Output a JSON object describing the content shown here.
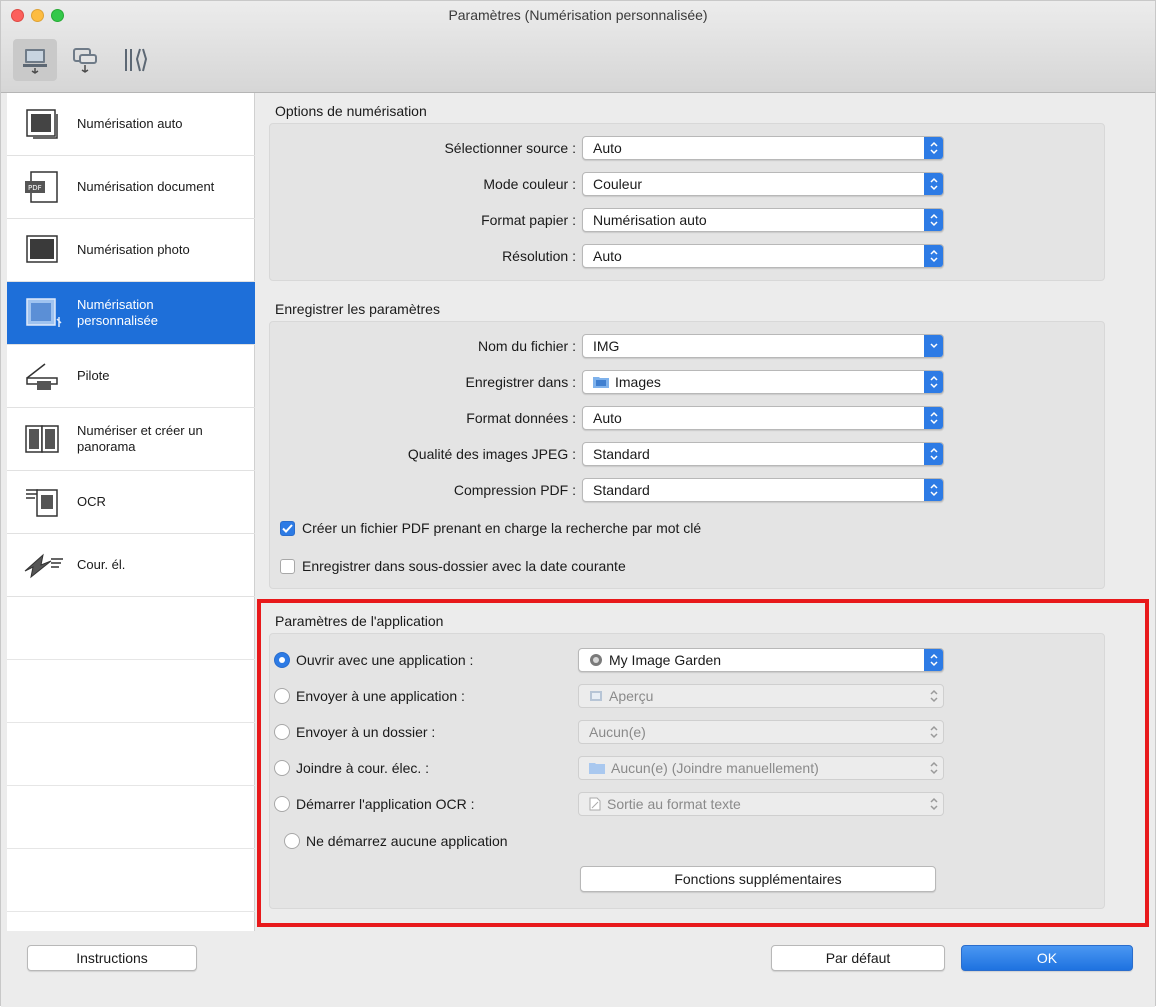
{
  "window": {
    "title": "Paramètres (Numérisation personnalisée)"
  },
  "toolbar": {
    "items": [
      {
        "icon": "computer-scan-icon",
        "active": true
      },
      {
        "icon": "network-scan-icon",
        "active": false
      },
      {
        "icon": "general-settings-icon",
        "active": false
      }
    ]
  },
  "sidebar": {
    "items": [
      {
        "label": "Numérisation auto",
        "icon": "auto-scan-icon"
      },
      {
        "label": "Numérisation document",
        "icon": "document-scan-icon"
      },
      {
        "label": "Numérisation photo",
        "icon": "photo-scan-icon"
      },
      {
        "label": "Numérisation personnalisée",
        "icon": "custom-scan-icon",
        "selected": true
      },
      {
        "label": "Pilote",
        "icon": "driver-icon"
      },
      {
        "label": "Numériser et créer un panorama",
        "icon": "panorama-icon"
      },
      {
        "label": "OCR",
        "icon": "ocr-icon"
      },
      {
        "label": "Cour. él.",
        "icon": "email-icon"
      }
    ]
  },
  "scan_options": {
    "title": "Options de numérisation",
    "rows": [
      {
        "label": "Sélectionner source :",
        "value": "Auto"
      },
      {
        "label": "Mode couleur :",
        "value": "Couleur"
      },
      {
        "label": "Format papier :",
        "value": "Numérisation auto"
      },
      {
        "label": "Résolution :",
        "value": "Auto"
      }
    ]
  },
  "save_settings": {
    "title": "Enregistrer les paramètres",
    "rows": [
      {
        "label": "Nom du fichier :",
        "value": "IMG"
      },
      {
        "label": "Enregistrer dans :",
        "value": "Images"
      },
      {
        "label": "Format données :",
        "value": "Auto"
      },
      {
        "label": "Qualité des images JPEG :",
        "value": "Standard"
      },
      {
        "label": "Compression PDF :",
        "value": "Standard"
      }
    ],
    "checkboxes": [
      {
        "label": "Créer un fichier PDF prenant en charge la recherche par mot clé",
        "checked": true
      },
      {
        "label": "Enregistrer dans sous-dossier avec la date courante",
        "checked": false
      }
    ]
  },
  "app_settings": {
    "title": "Paramètres de l'application",
    "options": [
      {
        "label": "Ouvrir avec une application :",
        "value": "My Image Garden",
        "selected": true,
        "enabled": true
      },
      {
        "label": "Envoyer à une application :",
        "value": "Aperçu",
        "selected": false,
        "enabled": false
      },
      {
        "label": "Envoyer à un dossier :",
        "value": "Aucun(e)",
        "selected": false,
        "enabled": false
      },
      {
        "label": "Joindre à cour. élec. :",
        "value": "Aucun(e) (Joindre manuellement)",
        "selected": false,
        "enabled": false
      },
      {
        "label": "Démarrer l'application OCR :",
        "value": "Sortie au format texte",
        "selected": false,
        "enabled": false
      },
      {
        "label": "Ne démarrez aucune application",
        "selected": false
      }
    ],
    "more_button": "Fonctions supplémentaires"
  },
  "footer": {
    "instructions": "Instructions",
    "default": "Par défaut",
    "ok": "OK"
  },
  "colors": {
    "accent": "#2d7be5",
    "selection": "#1e6fd9",
    "highlight": "#e8191b"
  }
}
